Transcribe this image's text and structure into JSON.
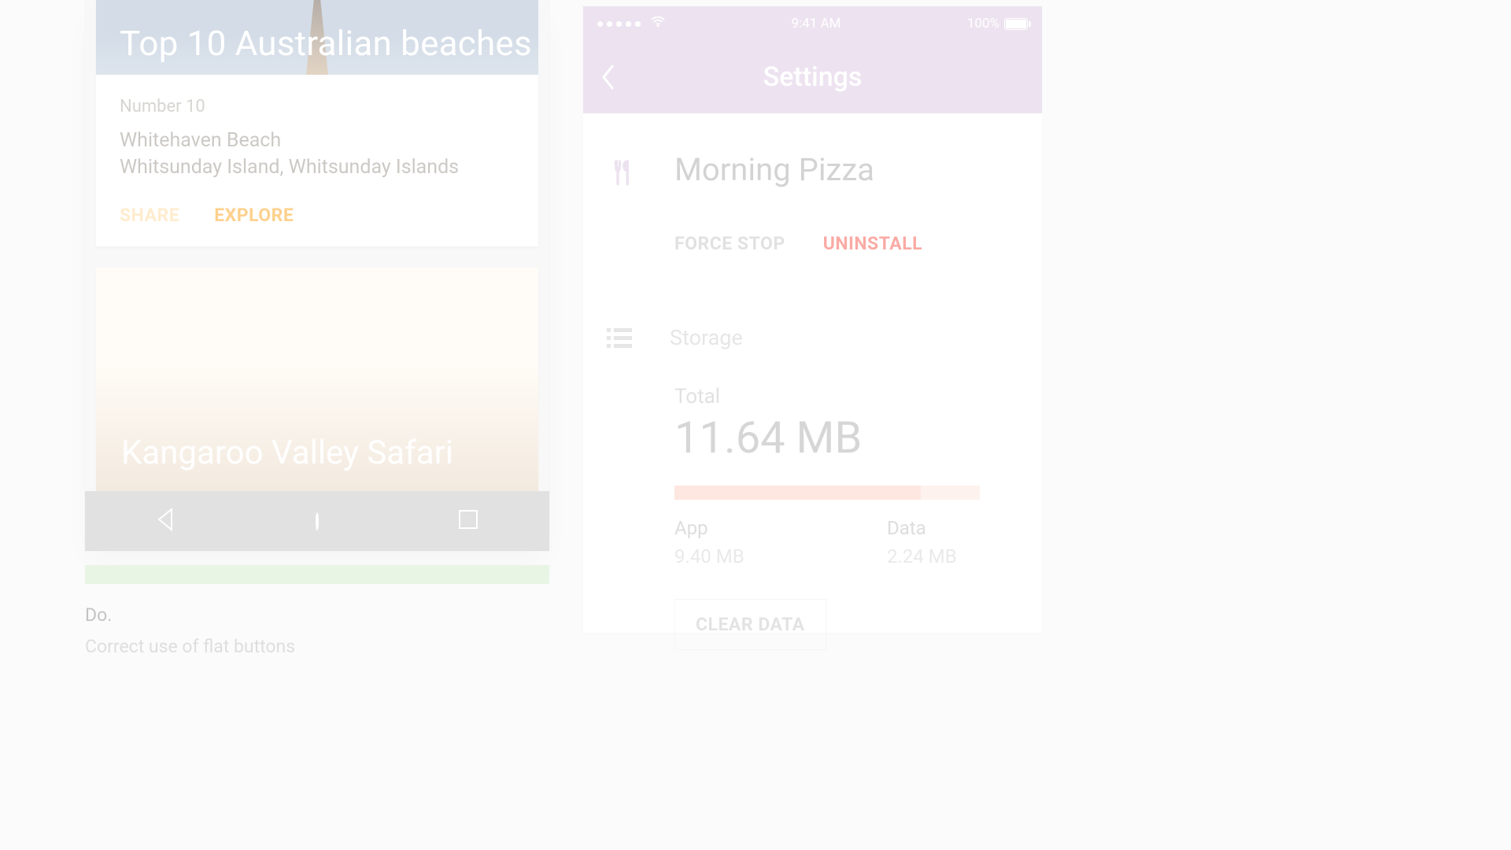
{
  "android": {
    "card1": {
      "title": "Top 10 Australian beaches",
      "overline": "Number 10",
      "line1": "Whitehaven Beach",
      "line2": "Whitsunday Island, Whitsunday Islands",
      "share_label": "SHARE",
      "explore_label": "EXPLORE"
    },
    "card2": {
      "title": "Kangaroo Valley Safari"
    },
    "caption_do": "Do.",
    "caption_sub": "Correct use of flat buttons"
  },
  "ios": {
    "status_time": "9:41 AM",
    "status_battery": "100%",
    "nav_title": "Settings",
    "app_name": "Morning Pizza",
    "force_stop_label": "FORCE STOP",
    "uninstall_label": "UNINSTALL",
    "storage_label": "Storage",
    "total_label": "Total",
    "total_value": "11.64 MB",
    "app_label": "App",
    "app_value": "9.40 MB",
    "data_label": "Data",
    "data_value": "2.24 MB",
    "app_pct": 80.76,
    "clear_label": "CLEAR DATA"
  }
}
